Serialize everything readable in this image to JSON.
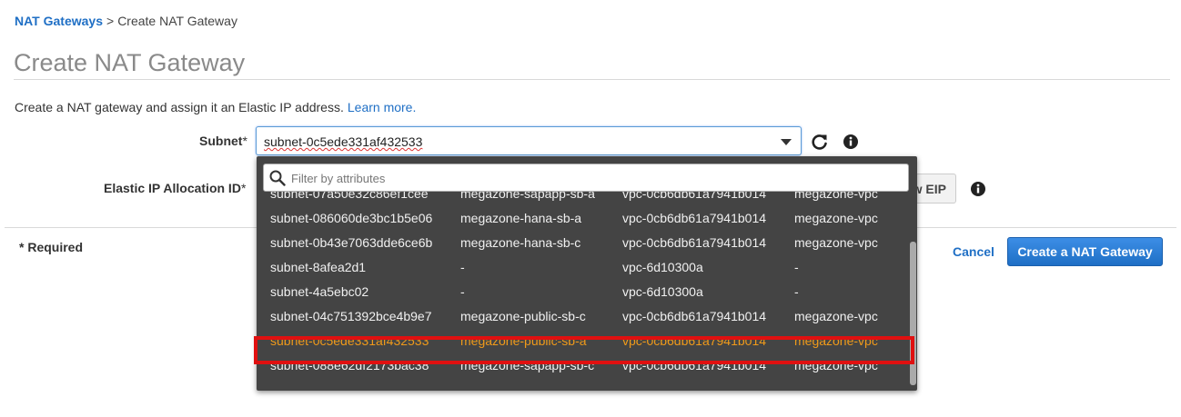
{
  "breadcrumb": {
    "parent": "NAT Gateways",
    "separator": ">",
    "current": "Create NAT Gateway"
  },
  "page": {
    "title": "Create NAT Gateway",
    "intro": "Create a NAT gateway and assign it an Elastic IP address.",
    "learn_more": "Learn more."
  },
  "form": {
    "subnet_label": "Subnet",
    "subnet_value": "subnet-0c5ede331af432533",
    "eip_label": "Elastic IP Allocation ID",
    "required_star": "*",
    "new_eip_fragment": "w EIP"
  },
  "dropdown": {
    "filter_placeholder": "Filter by attributes",
    "rows": [
      {
        "subnet": "subnet-07a50e32c86ef1cee",
        "name": "megazone-sapapp-sb-a",
        "vpc": "vpc-0cb6db61a7941b014",
        "vpc_name": "megazone-vpc"
      },
      {
        "subnet": "subnet-086060de3bc1b5e06",
        "name": "megazone-hana-sb-a",
        "vpc": "vpc-0cb6db61a7941b014",
        "vpc_name": "megazone-vpc"
      },
      {
        "subnet": "subnet-0b43e7063dde6ce6b",
        "name": "megazone-hana-sb-c",
        "vpc": "vpc-0cb6db61a7941b014",
        "vpc_name": "megazone-vpc"
      },
      {
        "subnet": "subnet-8afea2d1",
        "name": "-",
        "vpc": "vpc-6d10300a",
        "vpc_name": "-"
      },
      {
        "subnet": "subnet-4a5ebc02",
        "name": "-",
        "vpc": "vpc-6d10300a",
        "vpc_name": "-"
      },
      {
        "subnet": "subnet-04c751392bce4b9e7",
        "name": "megazone-public-sb-c",
        "vpc": "vpc-0cb6db61a7941b014",
        "vpc_name": "megazone-vpc"
      },
      {
        "subnet": "subnet-0c5ede331af432533",
        "name": "megazone-public-sb-a",
        "vpc": "vpc-0cb6db61a7941b014",
        "vpc_name": "megazone-vpc"
      },
      {
        "subnet": "subnet-088e62df2173bac38",
        "name": "megazone-sapapp-sb-c",
        "vpc": "vpc-0cb6db61a7941b014",
        "vpc_name": "megazone-vpc"
      }
    ],
    "selected_index": 6
  },
  "footer": {
    "required_note": "* Required",
    "cancel": "Cancel",
    "submit": "Create a NAT Gateway"
  },
  "colors": {
    "link": "#1f6fc5",
    "primary": "#1f6fc5",
    "dropdown_bg": "#444444",
    "selected": "#f09a1a",
    "highlight": "#e01010"
  }
}
